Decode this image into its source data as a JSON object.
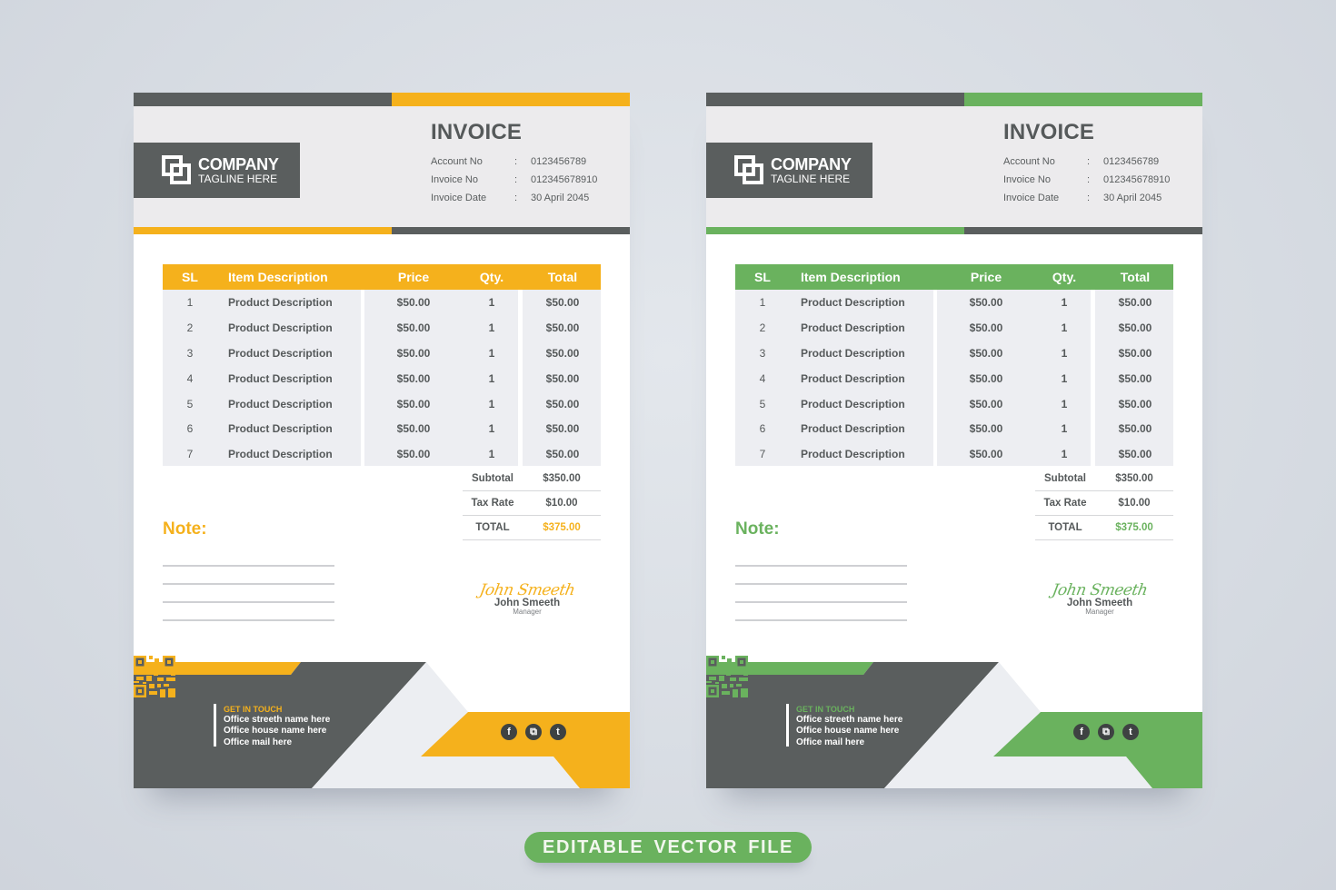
{
  "invoices": [
    {
      "variant": "orange",
      "accent_color": "#f5b11c",
      "company": {
        "name": "COMPANY",
        "tagline": "TAGLINE HERE",
        "logo_icon": "overlapping-squares-icon"
      },
      "title": "INVOICE",
      "meta": [
        {
          "label": "Account No",
          "sep": ":",
          "value": "0123456789"
        },
        {
          "label": "Invoice No",
          "sep": ":",
          "value": "012345678910"
        },
        {
          "label": "Invoice Date",
          "sep": ":",
          "value": "30 April 2045"
        }
      ],
      "table": {
        "headers": [
          "SL",
          "Item Description",
          "Price",
          "Qty.",
          "Total"
        ],
        "rows": [
          [
            "1",
            "Product Description",
            "$50.00",
            "1",
            "$50.00"
          ],
          [
            "2",
            "Product Description",
            "$50.00",
            "1",
            "$50.00"
          ],
          [
            "3",
            "Product Description",
            "$50.00",
            "1",
            "$50.00"
          ],
          [
            "4",
            "Product Description",
            "$50.00",
            "1",
            "$50.00"
          ],
          [
            "5",
            "Product Description",
            "$50.00",
            "1",
            "$50.00"
          ],
          [
            "6",
            "Product Description",
            "$50.00",
            "1",
            "$50.00"
          ],
          [
            "7",
            "Product Description",
            "$50.00",
            "1",
            "$50.00"
          ]
        ]
      },
      "totals": [
        {
          "label": "Subtotal",
          "value": "$350.00"
        },
        {
          "label": "Tax Rate",
          "value": "$10.00"
        },
        {
          "label": "TOTAL",
          "value": "$375.00"
        }
      ],
      "note_label": "Note:",
      "signature": {
        "script": "John Smeeth",
        "name": "John Smeeth",
        "role": "Manager"
      },
      "contact": {
        "heading": "GET IN TOUCH",
        "lines": [
          "Office streeth name here",
          "Office house name here",
          "Office mail here"
        ],
        "qr_icon": "qr-code-icon"
      },
      "socials": [
        {
          "icon": "facebook-icon",
          "glyph": "f"
        },
        {
          "icon": "instagram-icon",
          "glyph": "⧉"
        },
        {
          "icon": "twitter-icon",
          "glyph": "t"
        }
      ]
    },
    {
      "variant": "green",
      "accent_color": "#6ab25e",
      "company": {
        "name": "COMPANY",
        "tagline": "TAGLINE HERE",
        "logo_icon": "overlapping-squares-icon"
      },
      "title": "INVOICE",
      "meta": [
        {
          "label": "Account No",
          "sep": ":",
          "value": "0123456789"
        },
        {
          "label": "Invoice No",
          "sep": ":",
          "value": "012345678910"
        },
        {
          "label": "Invoice Date",
          "sep": ":",
          "value": "30 April 2045"
        }
      ],
      "table": {
        "headers": [
          "SL",
          "Item Description",
          "Price",
          "Qty.",
          "Total"
        ],
        "rows": [
          [
            "1",
            "Product Description",
            "$50.00",
            "1",
            "$50.00"
          ],
          [
            "2",
            "Product Description",
            "$50.00",
            "1",
            "$50.00"
          ],
          [
            "3",
            "Product Description",
            "$50.00",
            "1",
            "$50.00"
          ],
          [
            "4",
            "Product Description",
            "$50.00",
            "1",
            "$50.00"
          ],
          [
            "5",
            "Product Description",
            "$50.00",
            "1",
            "$50.00"
          ],
          [
            "6",
            "Product Description",
            "$50.00",
            "1",
            "$50.00"
          ],
          [
            "7",
            "Product Description",
            "$50.00",
            "1",
            "$50.00"
          ]
        ]
      },
      "totals": [
        {
          "label": "Subtotal",
          "value": "$350.00"
        },
        {
          "label": "Tax Rate",
          "value": "$10.00"
        },
        {
          "label": "TOTAL",
          "value": "$375.00"
        }
      ],
      "note_label": "Note:",
      "signature": {
        "script": "John Smeeth",
        "name": "John Smeeth",
        "role": "Manager"
      },
      "contact": {
        "heading": "GET IN TOUCH",
        "lines": [
          "Office streeth name here",
          "Office house name here",
          "Office mail here"
        ],
        "qr_icon": "qr-code-icon"
      },
      "socials": [
        {
          "icon": "facebook-icon",
          "glyph": "f"
        },
        {
          "icon": "instagram-icon",
          "glyph": "⧉"
        },
        {
          "icon": "twitter-icon",
          "glyph": "t"
        }
      ]
    }
  ],
  "badge": {
    "label": "EDITABLE VECTOR  FILE",
    "color": "#6ab25e"
  },
  "colors": {
    "dark_gray": "#5a5e5e",
    "light_gray": "#ecebed",
    "table_bg": "#edeef2",
    "background": "#d7dce3"
  }
}
